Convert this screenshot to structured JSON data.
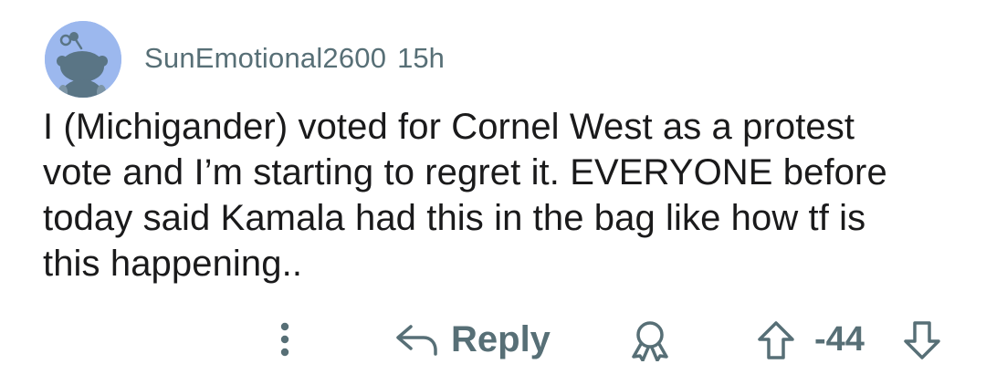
{
  "comment": {
    "username": "SunEmotional2600",
    "timestamp": "15h",
    "body_lines": [
      "I (Michigander) voted for Cornel West as a protest",
      "vote and I’m starting to regret it. EVERYONE before",
      "today said Kamala had this in the bag like how tf is",
      "this happening.."
    ],
    "avatar_icon": "reddit-snoo-avatar"
  },
  "actions": {
    "more_icon": "vertical-ellipsis-icon",
    "reply_label": "Reply",
    "reply_icon": "reply-arrow-icon",
    "award_icon": "award-icon",
    "upvote_icon": "upvote-arrow-icon",
    "score": "-44",
    "downvote_icon": "downvote-arrow-icon"
  },
  "colors": {
    "meta_text": "#576f76",
    "body_text": "#1a1a1b",
    "avatar_bg": "#9cb8ee",
    "avatar_figure": "#5a7585"
  }
}
